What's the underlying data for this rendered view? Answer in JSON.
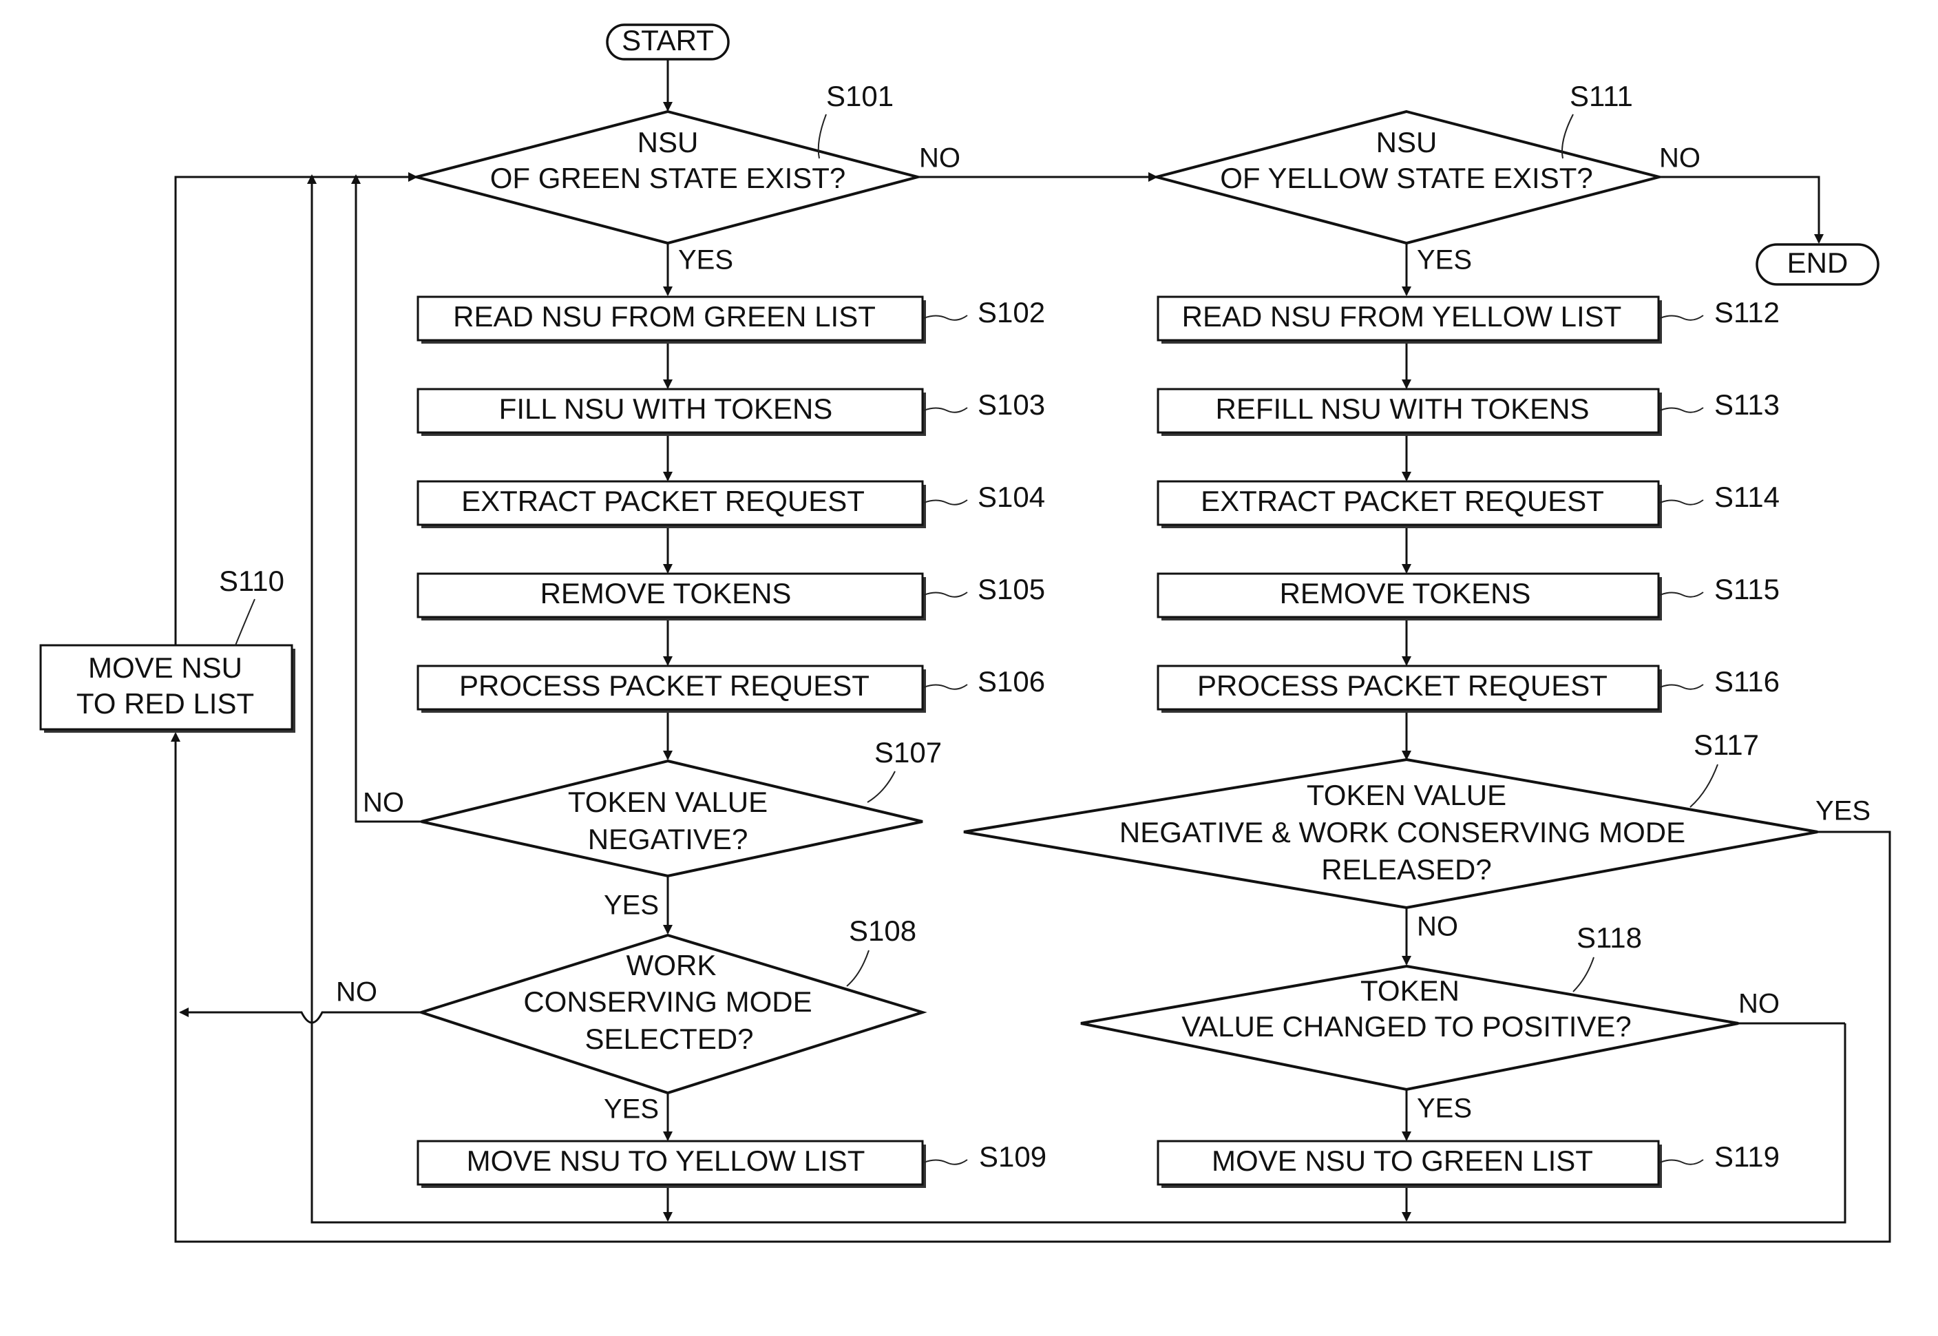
{
  "terminals": {
    "start": "START",
    "end": "END"
  },
  "decisions": {
    "s101": {
      "id": "S101",
      "lines": [
        "NSU",
        "OF GREEN STATE EXIST?"
      ]
    },
    "s107": {
      "id": "S107",
      "lines": [
        "TOKEN VALUE",
        "NEGATIVE?"
      ]
    },
    "s108": {
      "id": "S108",
      "lines": [
        "WORK",
        "CONSERVING MODE",
        "SELECTED?"
      ]
    },
    "s111": {
      "id": "S111",
      "lines": [
        "NSU",
        "OF YELLOW STATE EXIST?"
      ]
    },
    "s117": {
      "id": "S117",
      "lines": [
        "TOKEN VALUE",
        "NEGATIVE & WORK CONSERVING MODE",
        "RELEASED?"
      ]
    },
    "s118": {
      "id": "S118",
      "lines": [
        "TOKEN",
        "VALUE CHANGED TO POSITIVE?"
      ]
    }
  },
  "processes": {
    "s102": {
      "id": "S102",
      "label": "READ NSU FROM GREEN LIST"
    },
    "s103": {
      "id": "S103",
      "label": "FILL NSU WITH TOKENS"
    },
    "s104": {
      "id": "S104",
      "label": "EXTRACT PACKET REQUEST"
    },
    "s105": {
      "id": "S105",
      "label": "REMOVE TOKENS"
    },
    "s106": {
      "id": "S106",
      "label": "PROCESS PACKET REQUEST"
    },
    "s109": {
      "id": "S109",
      "label": "MOVE NSU TO YELLOW LIST"
    },
    "s110": {
      "id": "S110",
      "lines": [
        "MOVE NSU",
        "TO RED LIST"
      ]
    },
    "s112": {
      "id": "S112",
      "label": "READ NSU FROM YELLOW LIST"
    },
    "s113": {
      "id": "S113",
      "label": "REFILL NSU WITH TOKENS"
    },
    "s114": {
      "id": "S114",
      "label": "EXTRACT PACKET REQUEST"
    },
    "s115": {
      "id": "S115",
      "label": "REMOVE TOKENS"
    },
    "s116": {
      "id": "S116",
      "label": "PROCESS PACKET REQUEST"
    },
    "s119": {
      "id": "S119",
      "label": "MOVE NSU TO GREEN LIST"
    }
  },
  "branch_labels": {
    "yes": "YES",
    "no": "NO"
  }
}
